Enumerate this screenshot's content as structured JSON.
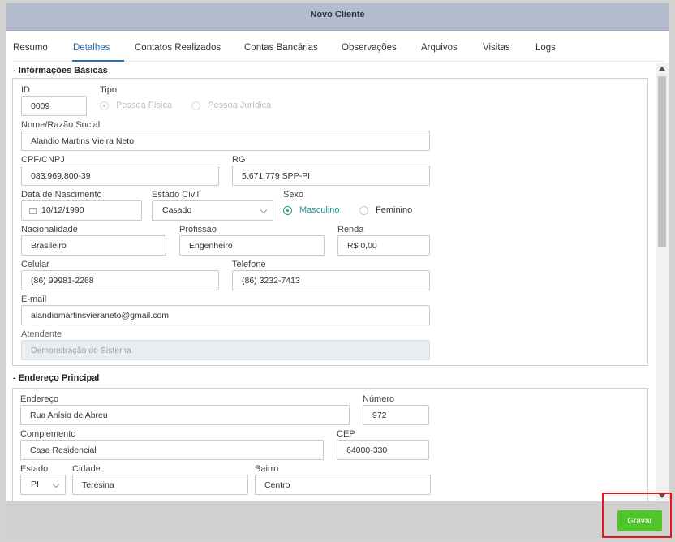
{
  "window": {
    "title": "Novo Cliente"
  },
  "tabs": [
    "Resumo",
    "Detalhes",
    "Contatos Realizados",
    "Contas Bancárias",
    "Observações",
    "Arquivos",
    "Visitas",
    "Logs"
  ],
  "active_tab": "Detalhes",
  "basic_info": {
    "section_title": "- Informações Básicas",
    "id": {
      "label": "ID",
      "value": "0009"
    },
    "tipo": {
      "label": "Tipo",
      "options": [
        "Pessoa Física",
        "Pessoa Jurídica"
      ],
      "selected": "Pessoa Física"
    },
    "nome": {
      "label": "Nome/Razão Social",
      "value": "Alandio Martins Vieira Neto"
    },
    "cpf": {
      "label": "CPF/CNPJ",
      "value": "083.969.800-39"
    },
    "rg": {
      "label": "RG",
      "value": "5.671.779 SPP-PI"
    },
    "nascimento": {
      "label": "Data de Nascimento",
      "value": "10/12/1990"
    },
    "estado_civil": {
      "label": "Estado Civil",
      "value": "Casado"
    },
    "sexo": {
      "label": "Sexo",
      "options": [
        "Masculino",
        "Feminino"
      ],
      "selected": "Masculino"
    },
    "nacionalidade": {
      "label": "Nacionalidade",
      "value": "Brasileiro"
    },
    "profissao": {
      "label": "Profissão",
      "value": "Engenheiro"
    },
    "renda": {
      "label": "Renda",
      "value": "R$ 0,00"
    },
    "celular": {
      "label": "Celular",
      "value": "(86) 99981-2268"
    },
    "telefone": {
      "label": "Telefone",
      "value": "(86) 3232-7413"
    },
    "email": {
      "label": "E-mail",
      "value": "alandiomartinsvieraneto@gmail.com"
    },
    "atendente": {
      "label": "Atendente",
      "value": "Demonstração do Sistema"
    }
  },
  "address": {
    "section_title": "- Endereço Principal",
    "endereco": {
      "label": "Endereço",
      "value": "Rua Anísio de Abreu"
    },
    "numero": {
      "label": "Número",
      "value": "972"
    },
    "complemento": {
      "label": "Complemento",
      "value": "Casa Residencial"
    },
    "cep": {
      "label": "CEP",
      "value": "64000-330"
    },
    "estado": {
      "label": "Estado",
      "value": "PI"
    },
    "cidade": {
      "label": "Cidade",
      "value": "Teresina"
    },
    "bairro": {
      "label": "Bairro",
      "value": "Centro"
    }
  },
  "footer": {
    "save_label": "Gravar"
  },
  "colors": {
    "accent": "#2b6cb0",
    "radio_checked": "#1f9a8a",
    "save_button": "#4fc72b",
    "highlight": "#e8171c",
    "titlebar": "#b4bdce"
  }
}
